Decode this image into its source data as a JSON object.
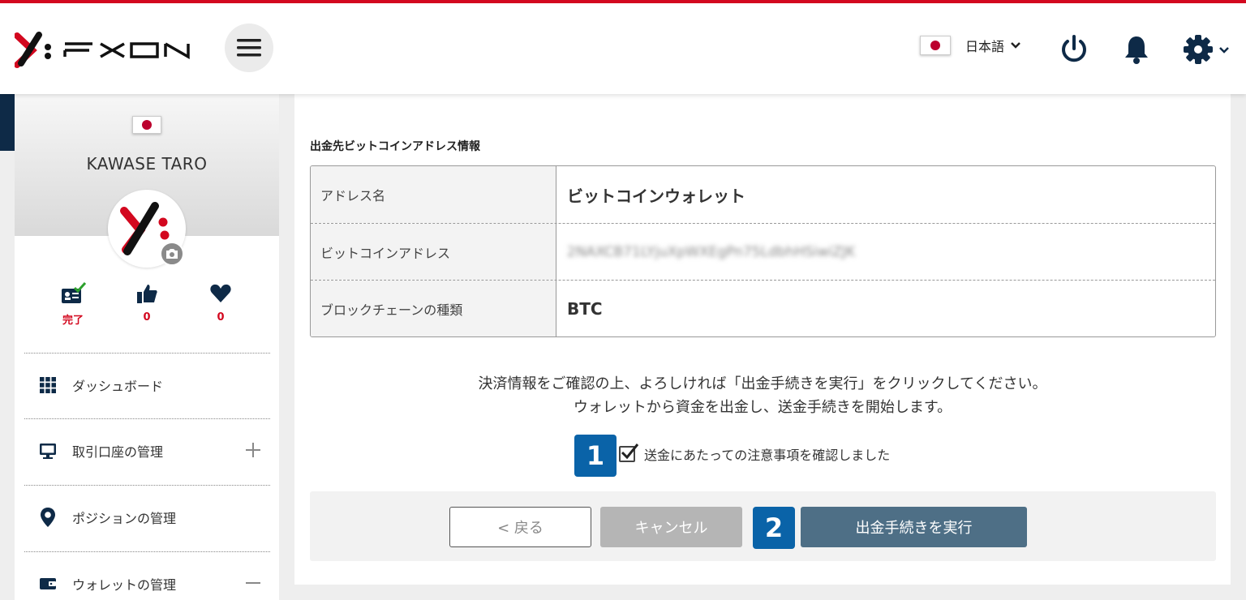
{
  "header": {
    "brand": "FXON",
    "language": "日本語",
    "colors": {
      "accent": "#d3081f",
      "primary": "#0a63a8",
      "exec_button": "#4e6f86"
    }
  },
  "sidebar": {
    "username": "KAWASE TARO",
    "stats": [
      {
        "icon": "id-card-check-icon",
        "value": "完了"
      },
      {
        "icon": "thumbs-up-icon",
        "value": "0"
      },
      {
        "icon": "heart-icon",
        "value": "0"
      }
    ],
    "menu": [
      {
        "icon": "grid-icon",
        "label": "ダッシュボード"
      },
      {
        "icon": "monitor-icon",
        "label": "取引口座の管理"
      },
      {
        "icon": "location-pin-icon",
        "label": "ポジションの管理"
      },
      {
        "icon": "wallet-icon",
        "label": "ウォレットの管理"
      }
    ]
  },
  "main": {
    "section_title": "出金先ビットコインアドレス情報",
    "rows": [
      {
        "label": "アドレス名",
        "value": "ビットコインウォレット"
      },
      {
        "label": "ビットコインアドレス",
        "value": "2NAXCB71LYjuXpWXEgPn75LdbhHSiwiZJK"
      },
      {
        "label": "ブロックチェーンの種類",
        "value": "BTC"
      }
    ],
    "confirm_line1": "決済情報をご確認の上、よろしければ「出金手続きを実行」をクリックしてください。",
    "confirm_line2": "ウォレットから資金を出金し、送金手続きを開始します。",
    "checkbox_label": "送金にあたっての注意事項を確認しました",
    "checkbox_checked": true,
    "badge1": "1",
    "badge2": "2",
    "buttons": {
      "back": "< 戻る",
      "cancel": "キャンセル",
      "execute": "出金手続きを実行"
    }
  }
}
